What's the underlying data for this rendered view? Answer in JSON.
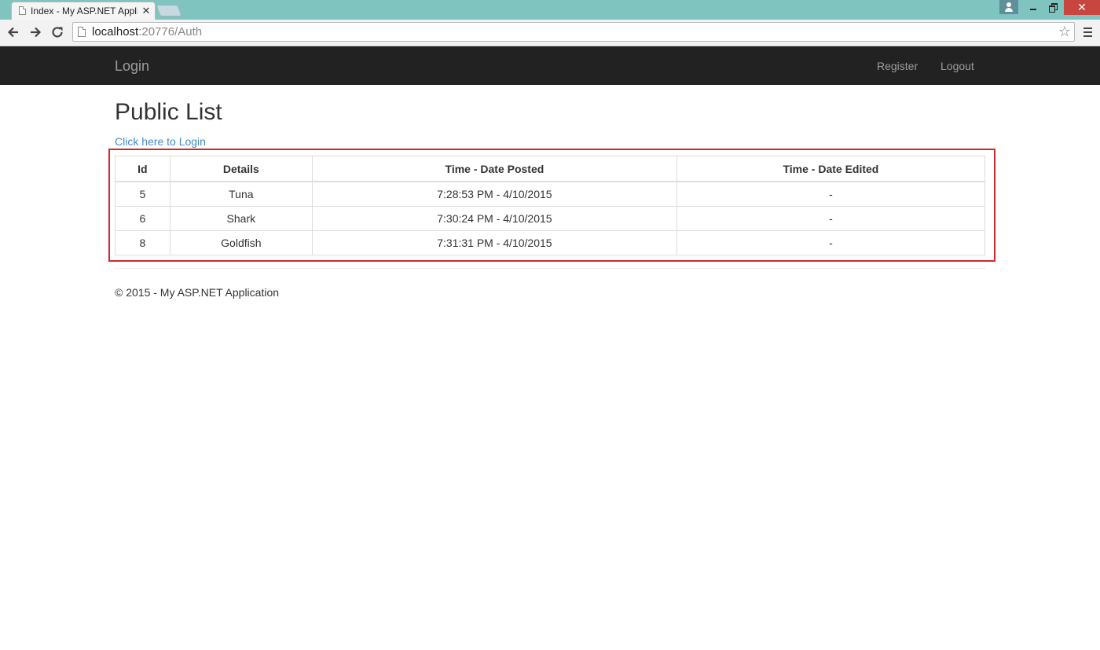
{
  "browser": {
    "tab_title": "Index - My ASP.NET Appli",
    "tab_close_glyph": "✕",
    "url_host": "localhost",
    "url_path": ":20776/Auth",
    "star_glyph": "☆",
    "close_glyph": "✕"
  },
  "navbar": {
    "brand": "Login",
    "links": [
      "Register",
      "Logout"
    ]
  },
  "main": {
    "title": "Public List",
    "login_link": "Click here to Login"
  },
  "table": {
    "headers": [
      "Id",
      "Details",
      "Time - Date Posted",
      "Time - Date Edited"
    ],
    "rows": [
      [
        "5",
        "Tuna",
        "7:28:53 PM - 4/10/2015",
        "-"
      ],
      [
        "6",
        "Shark",
        "7:30:24 PM - 4/10/2015",
        "-"
      ],
      [
        "8",
        "Goldfish",
        "7:31:31 PM - 4/10/2015",
        "-"
      ]
    ]
  },
  "footer": {
    "text": "© 2015 - My ASP.NET Application"
  },
  "colors": {
    "tabstrip": "#7fc4bf",
    "navbar": "#222222",
    "link": "#428bca",
    "highlight": "#cc2a2f"
  }
}
